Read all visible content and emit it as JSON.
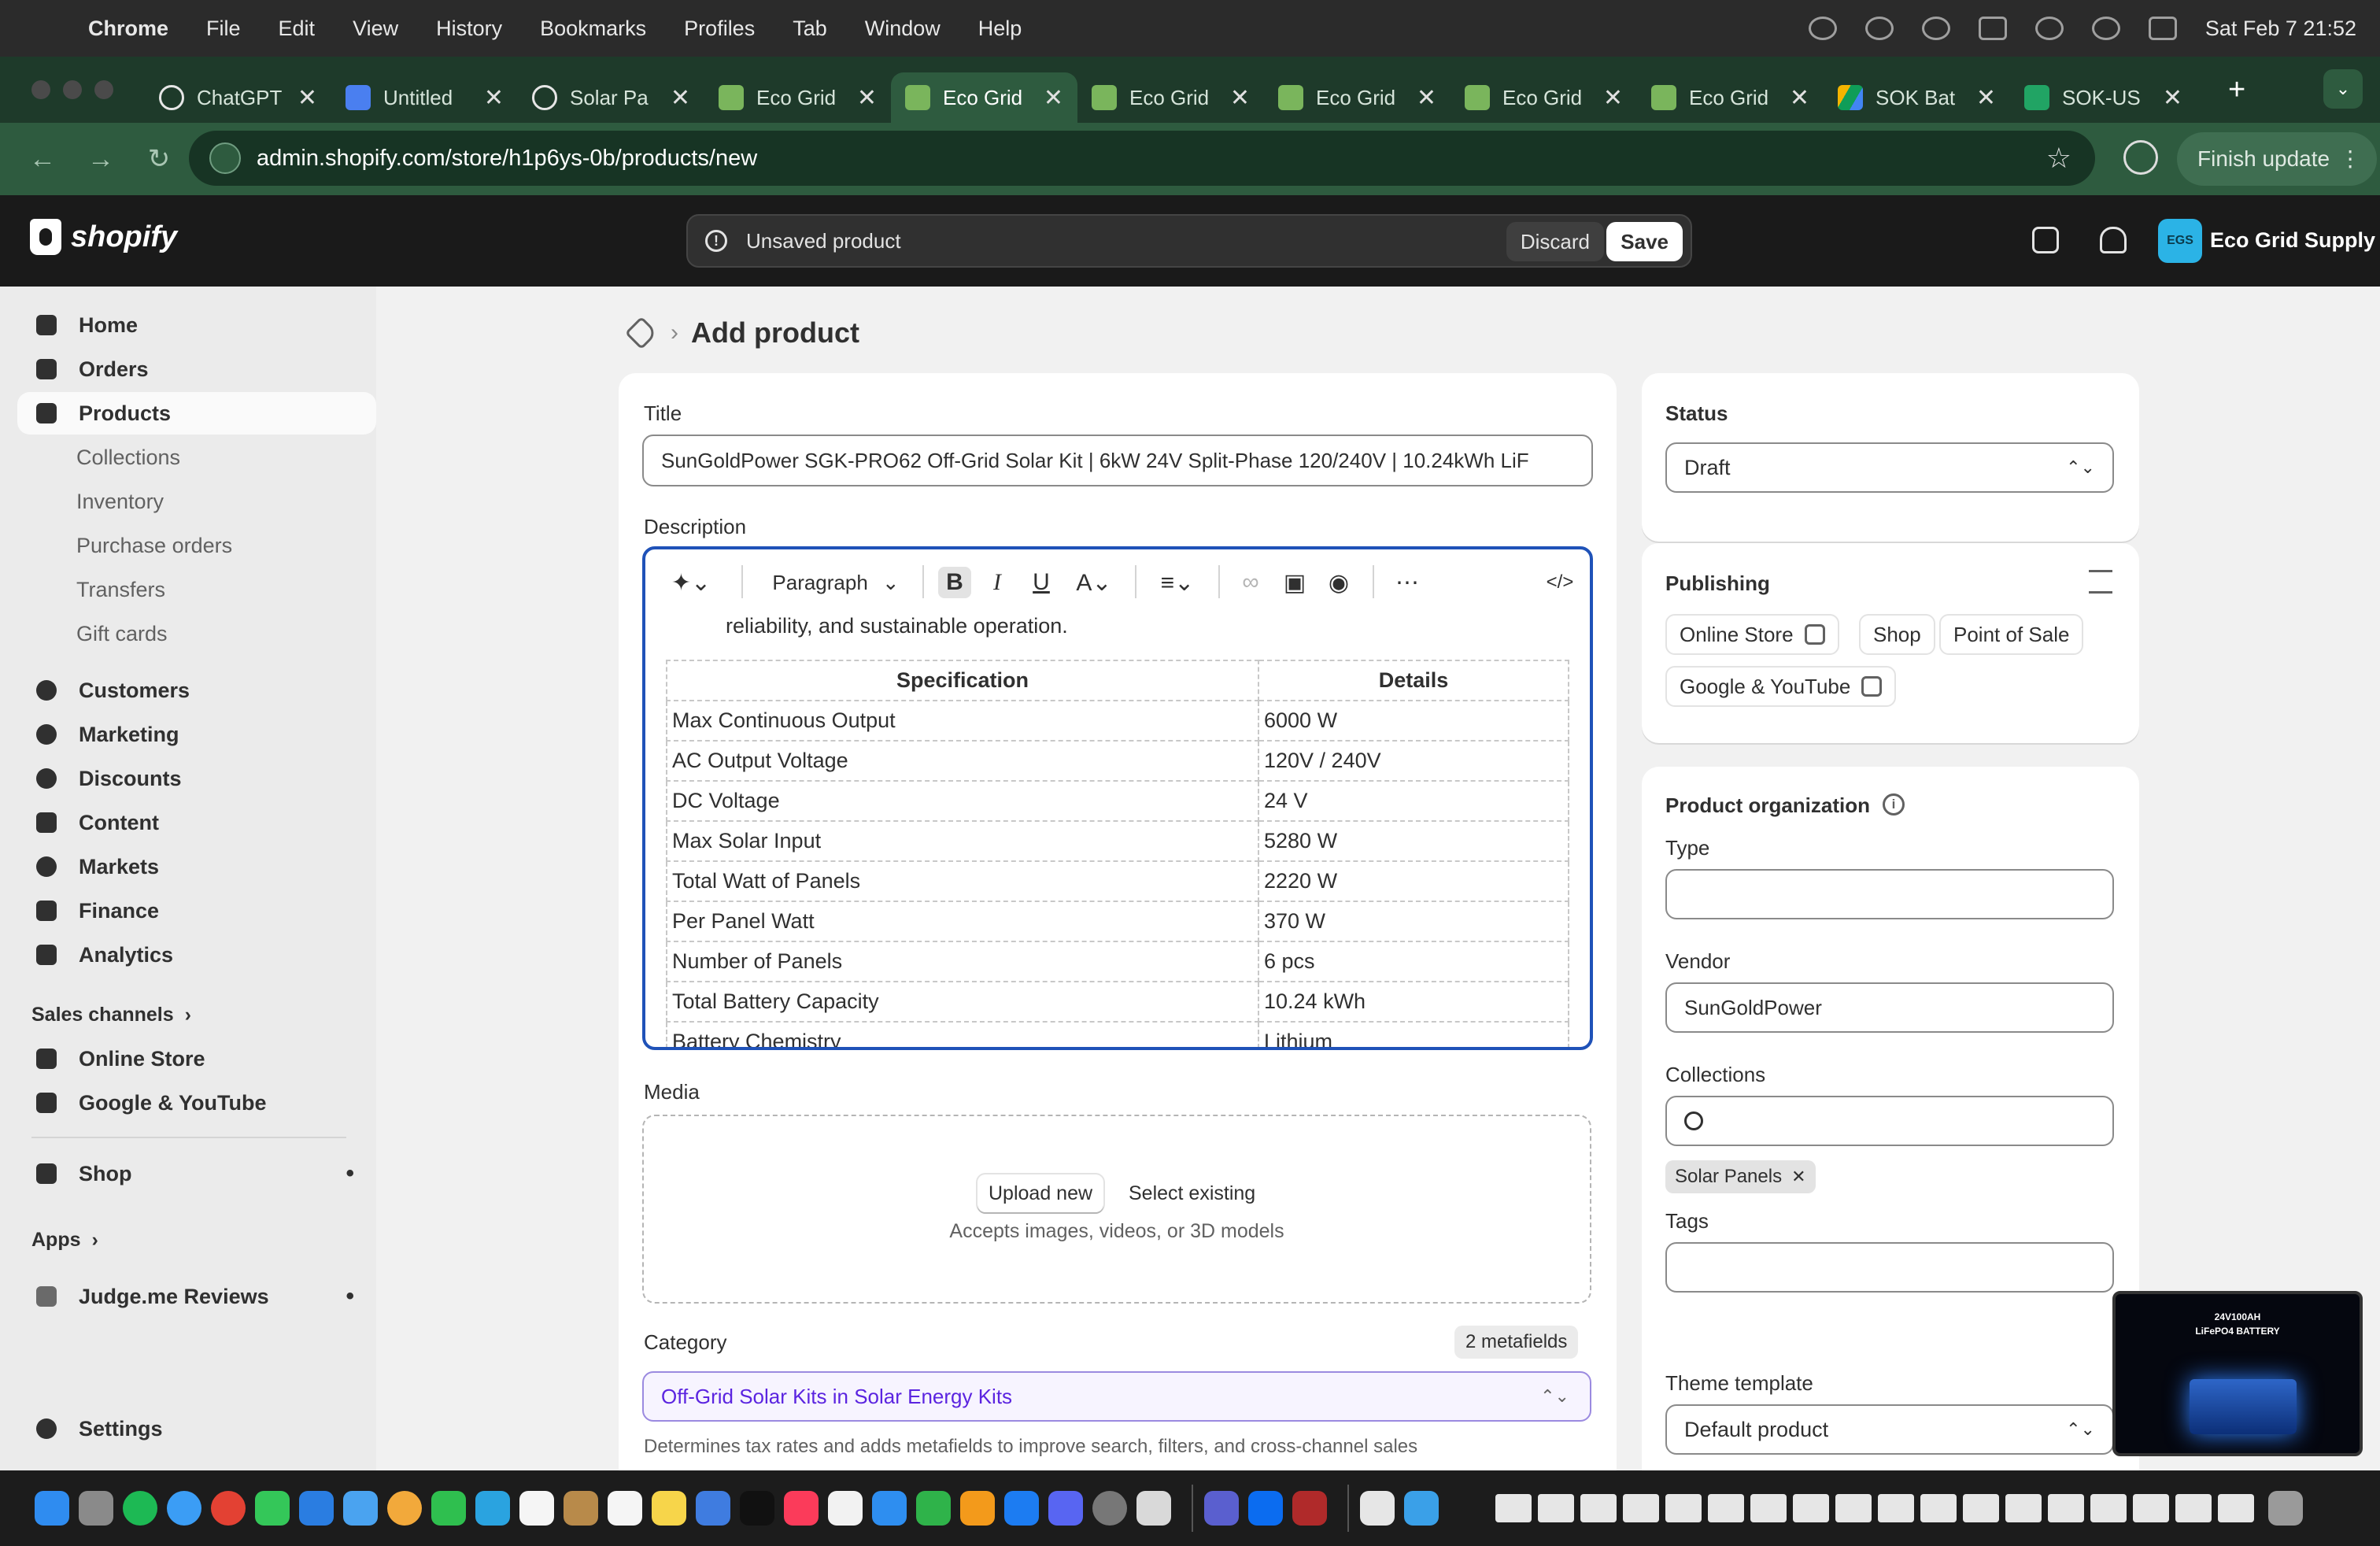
{
  "menubar": {
    "app": "Chrome",
    "items": [
      "File",
      "Edit",
      "View",
      "History",
      "Bookmarks",
      "Profiles",
      "Tab",
      "Window",
      "Help"
    ],
    "clock": "Sat Feb 7  21:52"
  },
  "tabs": [
    {
      "title": "ChatGPT",
      "icon": "chatgpt-icon"
    },
    {
      "title": "Untitled",
      "icon": "docs-icon"
    },
    {
      "title": "Solar Pa",
      "icon": "chatgpt-icon"
    },
    {
      "title": "Eco Grid",
      "icon": "shopify-icon"
    },
    {
      "title": "Eco Grid",
      "icon": "shopify-icon",
      "active": true
    },
    {
      "title": "Eco Grid",
      "icon": "shopify-icon"
    },
    {
      "title": "Eco Grid",
      "icon": "shopify-icon"
    },
    {
      "title": "Eco Grid",
      "icon": "shopify-icon"
    },
    {
      "title": "Eco Grid",
      "icon": "shopify-icon"
    },
    {
      "title": "SOK Bat",
      "icon": "drive-icon"
    },
    {
      "title": "SOK-US",
      "icon": "sheets-icon"
    }
  ],
  "browser": {
    "url": "admin.shopify.com/store/h1p6ys-0b/products/new",
    "finish_update": "Finish update"
  },
  "header": {
    "logo": "shopify",
    "unsaved": "Unsaved product",
    "discard": "Discard",
    "save": "Save",
    "store_initials": "EGS",
    "store_name": "Eco Grid Supply"
  },
  "sidebar": {
    "items": [
      {
        "label": "Home"
      },
      {
        "label": "Orders"
      },
      {
        "label": "Products",
        "active": true
      },
      {
        "label": "Collections"
      },
      {
        "label": "Inventory"
      },
      {
        "label": "Purchase orders"
      },
      {
        "label": "Transfers"
      },
      {
        "label": "Gift cards"
      },
      {
        "label": "Customers"
      },
      {
        "label": "Marketing"
      },
      {
        "label": "Discounts"
      },
      {
        "label": "Content"
      },
      {
        "label": "Markets"
      },
      {
        "label": "Finance"
      },
      {
        "label": "Analytics"
      }
    ],
    "sales_channels": "Sales channels",
    "channels": [
      "Online Store",
      "Google & YouTube"
    ],
    "shop": "Shop",
    "apps": "Apps",
    "app_items": [
      "Judge.me Reviews"
    ],
    "settings": "Settings"
  },
  "page": {
    "title": "Add product",
    "title_label": "Title",
    "title_value": "SunGoldPower SGK-PRO62 Off-Grid Solar Kit | 6kW 24V Split-Phase 120/240V | 10.24kWh LiF",
    "description_label": "Description",
    "toolbar": {
      "paragraph": "Paragraph"
    },
    "desc_text": "reliability, and sustainable operation.",
    "spec_headers": [
      "Specification",
      "Details"
    ],
    "spec_rows": [
      [
        "Max Continuous Output",
        "6000 W"
      ],
      [
        "AC Output Voltage",
        "120V / 240V"
      ],
      [
        "DC Voltage",
        "24 V"
      ],
      [
        "Max Solar Input",
        "5280 W"
      ],
      [
        "Total Watt of Panels",
        "2220 W"
      ],
      [
        "Per Panel Watt",
        "370 W"
      ],
      [
        "Number of Panels",
        "6 pcs"
      ],
      [
        "Total Battery Capacity",
        "10.24 kWh"
      ],
      [
        "Battery Chemistry",
        "Lithium"
      ]
    ],
    "media_label": "Media",
    "upload_new": "Upload new",
    "select_existing": "Select existing",
    "media_help": "Accepts images, videos, or 3D models",
    "category_label": "Category",
    "metafields": "2 metafields",
    "category_main": "Off-Grid Solar Kits",
    "category_in": "in",
    "category_parent": "Solar Energy Kits",
    "category_help": "Determines tax rates and adds metafields to improve search, filters, and cross-channel sales"
  },
  "right": {
    "status_label": "Status",
    "status_value": "Draft",
    "publishing_label": "Publishing",
    "publishing": [
      "Online Store",
      "Shop",
      "Point of Sale",
      "Google & YouTube"
    ],
    "org_label": "Product organization",
    "type_label": "Type",
    "type_value": "",
    "vendor_label": "Vendor",
    "vendor_value": "SunGoldPower",
    "collections_label": "Collections",
    "collection_chip": "Solar Panels",
    "tags_label": "Tags",
    "theme_label": "Theme template",
    "theme_value": "Default product"
  },
  "pip": {
    "line1": "24V100AH",
    "line2": "LiFePO4 BATTERY"
  }
}
